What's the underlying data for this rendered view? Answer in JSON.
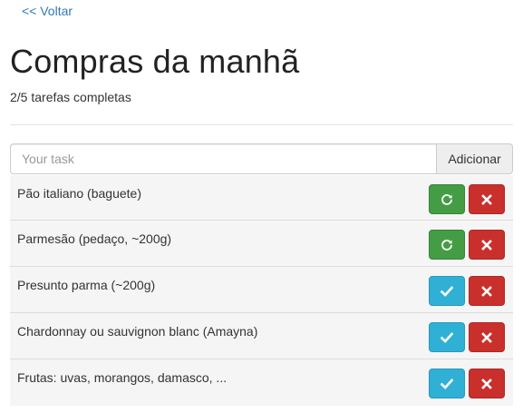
{
  "nav": {
    "back_label": "<< Voltar"
  },
  "header": {
    "title": "Compras da manhã",
    "progress": "2/5 tarefas completas",
    "completed": 2,
    "total": 5
  },
  "new_task": {
    "placeholder": "Your task",
    "value": "",
    "add_label": "Adicionar"
  },
  "tasks": [
    {
      "label": "Pão italiano (baguete)",
      "completed": true
    },
    {
      "label": "Parmesão (pedaço, ~200g)",
      "completed": true
    },
    {
      "label": "Presunto parma (~200g)",
      "completed": false
    },
    {
      "label": "Chardonnay ou sauvignon blanc (Amayna)",
      "completed": false
    },
    {
      "label": "Frutas: uvas, morangos, damasco, ...",
      "completed": false
    }
  ],
  "colors": {
    "link": "#337ab7",
    "success": "#449d44",
    "info": "#31b0d5",
    "danger": "#c9302c",
    "row_background": "#f5f5f5"
  },
  "icons": {
    "undo": "refresh-icon",
    "complete": "check-icon",
    "delete": "close-icon"
  }
}
